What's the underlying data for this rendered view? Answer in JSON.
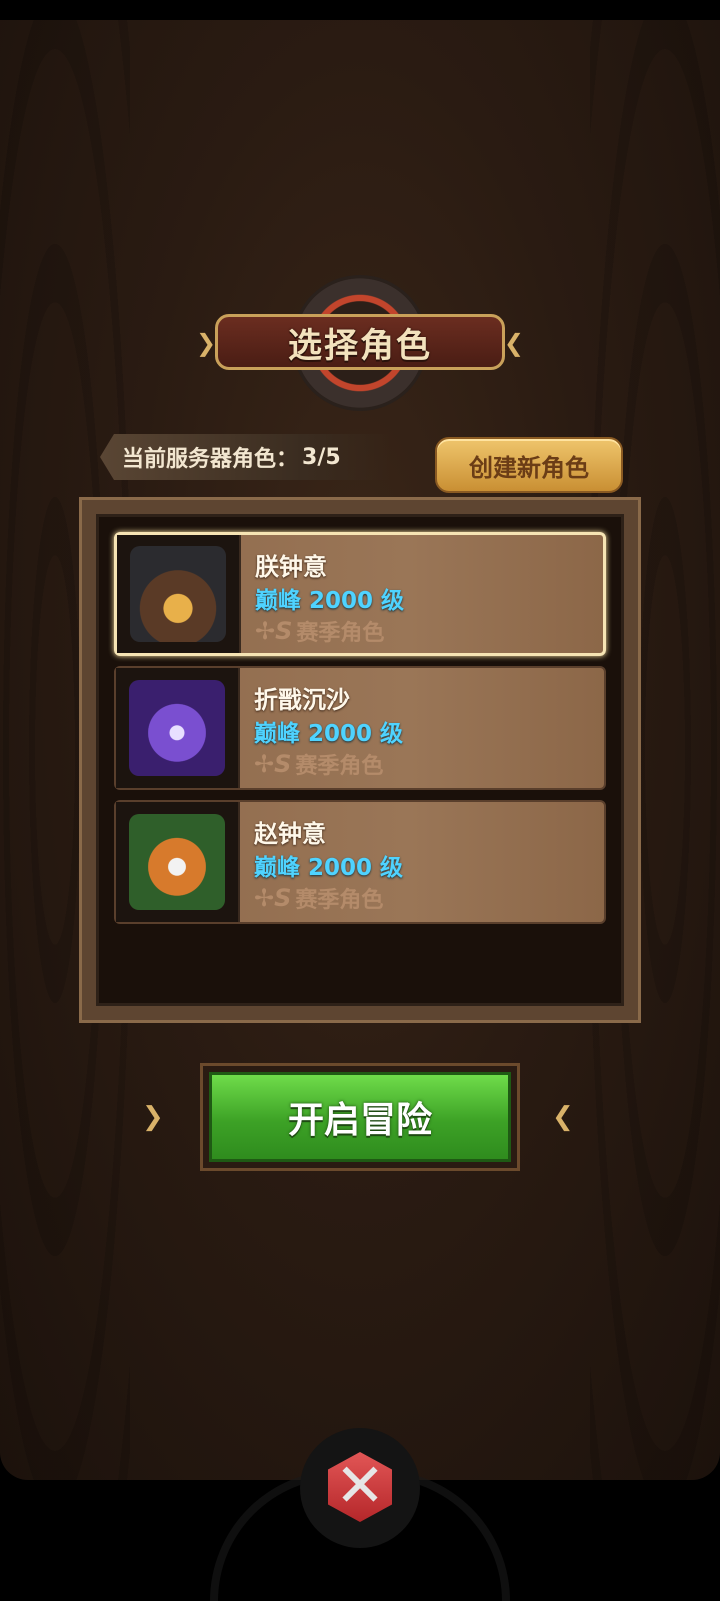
{
  "title": "选择角色",
  "server": {
    "label": "当前服务器角色：",
    "count": "3/5",
    "create_button": "创建新角色"
  },
  "characters": [
    {
      "name": "朕钟意",
      "level": "巅峰 2000 级",
      "tag": "赛季角色",
      "avatar": "bear-warrior-helmet",
      "selected": true
    },
    {
      "name": "折戬沉沙",
      "level": "巅峰 2000 级",
      "tag": "赛季角色",
      "avatar": "purple-wizard",
      "selected": false
    },
    {
      "name": "赵钟意",
      "level": "巅峰 2000 级",
      "tag": "赛季角色",
      "avatar": "green-hooded-fox",
      "selected": false
    }
  ],
  "start_button": "开启冒险",
  "icons": {
    "season": "s-season-icon",
    "emblem": "crossed-swords-gem-icon"
  },
  "colors": {
    "level_text": "#4fd3ff",
    "start_button": "#3da226",
    "create_button": "#e0ac52"
  }
}
